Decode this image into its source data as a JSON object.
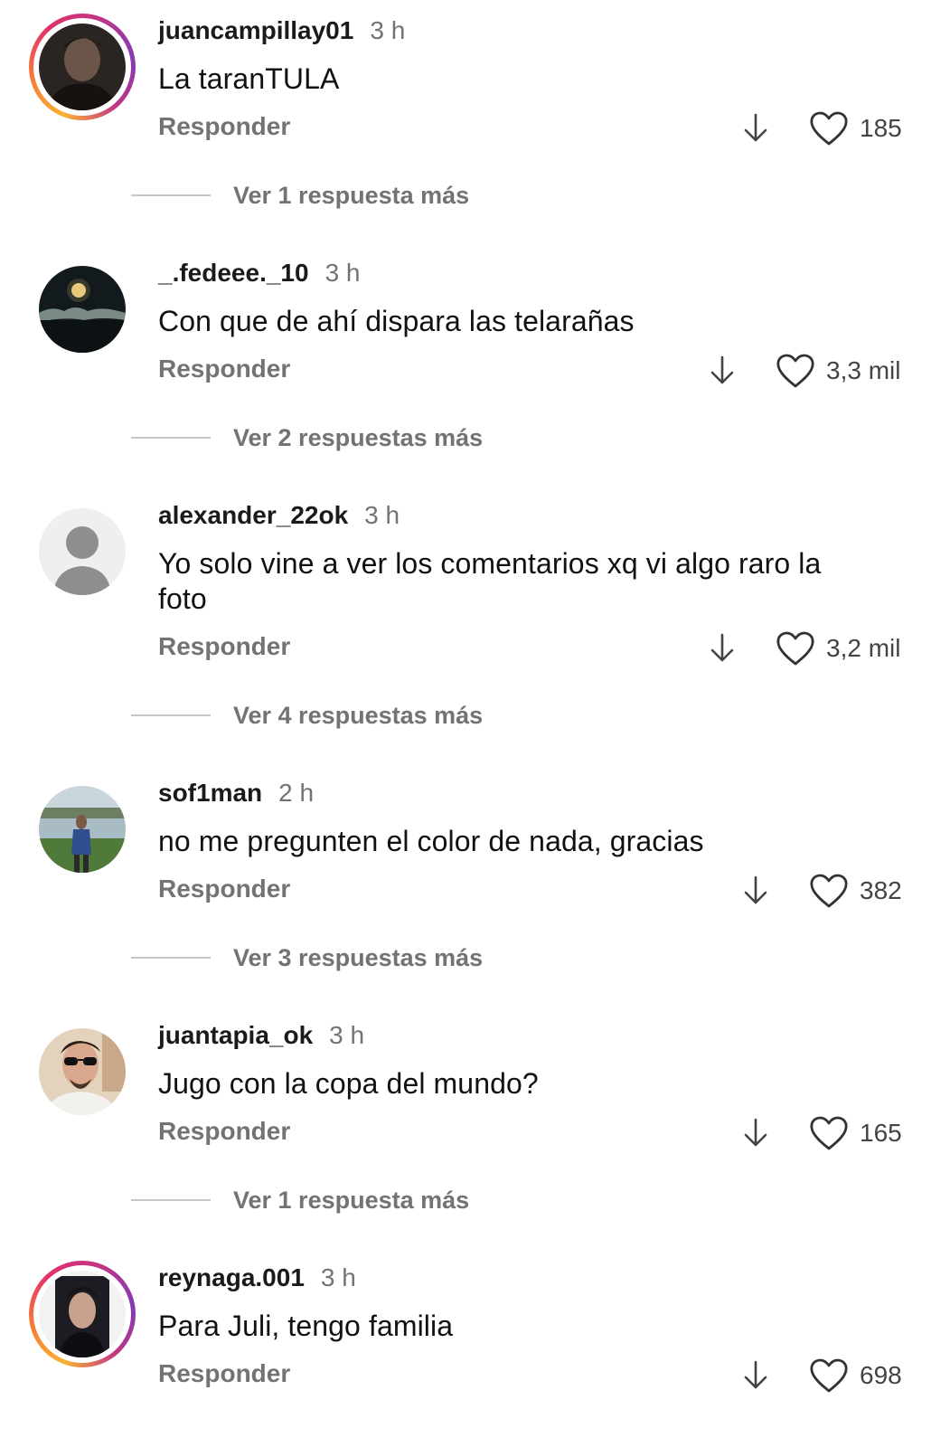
{
  "comments": [
    {
      "username": "juancampillay01",
      "time": "3 h",
      "text": "La taranTULA",
      "reply_label": "Responder",
      "likes": "185",
      "view_replies": "Ver 1 respuesta más",
      "avatar": "portrait-dark"
    },
    {
      "username": "_.fedeee._10",
      "time": "3 h",
      "text": "Con que de ahí dispara las telarañas",
      "reply_label": "Responder",
      "likes": "3,3 mil",
      "view_replies": "Ver 2 respuestas más",
      "avatar": "night-moon"
    },
    {
      "username": "alexander_22ok",
      "time": "3 h",
      "text": "Yo solo vine a ver los comentarios xq vi algo raro la foto",
      "reply_label": "Responder",
      "likes": "3,2 mil",
      "view_replies": "Ver 4 respuestas más",
      "avatar": "default-placeholder"
    },
    {
      "username": "sof1man",
      "time": "2 h",
      "text": "no me pregunten el color de nada, gracias",
      "reply_label": "Responder",
      "likes": "382",
      "view_replies": "Ver 3 respuestas más",
      "avatar": "lake-person"
    },
    {
      "username": "juantapia_ok",
      "time": "3 h",
      "text": "Jugo con la copa del mundo?",
      "reply_label": "Responder",
      "likes": "165",
      "view_replies": "Ver 1 respuesta más",
      "avatar": "portrait-sunglasses"
    },
    {
      "username": "reynaga.001",
      "time": "3 h",
      "text": "Para Juli, tengo familia",
      "reply_label": "Responder",
      "likes": "698",
      "view_replies": "",
      "avatar": "portrait-night"
    }
  ],
  "icons": {
    "dislike": "arrow-down-icon",
    "like": "heart-outline-icon",
    "story_ring": "gradient-story-ring"
  },
  "colors": {
    "text_primary": "#111111",
    "text_secondary": "#737373",
    "divider": "#c7c7c7",
    "background": "#ffffff"
  }
}
